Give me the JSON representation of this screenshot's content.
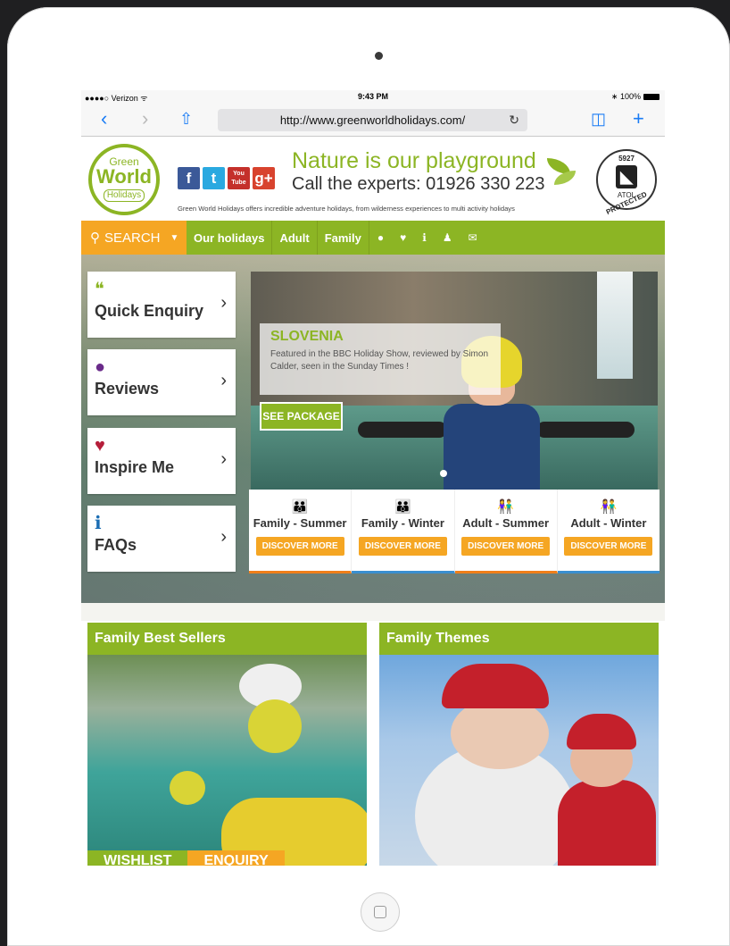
{
  "status_bar": {
    "carrier": "●●●●○ Verizon",
    "wifi": "ᯤ",
    "time": "9:43 PM",
    "battery": "100%",
    "bt": "∗"
  },
  "browser": {
    "url": "http://www.greenworldholidays.com/",
    "reload": "↻"
  },
  "logo": {
    "line1": "Green",
    "line2": "World",
    "line3": "Holidays"
  },
  "social": [
    {
      "name": "facebook",
      "glyph": "f",
      "color": "#3b5998"
    },
    {
      "name": "twitter",
      "glyph": "t",
      "color": "#2aa9e0"
    },
    {
      "name": "youtube",
      "glyph": "You Tube",
      "color": "#c4302b"
    },
    {
      "name": "google-plus",
      "glyph": "g+",
      "color": "#d8432e"
    }
  ],
  "header": {
    "tagline": "Nature is our playground",
    "phone": "Call the experts: 01926 330 223",
    "subtitle": "Green World Holidays offers incredible adventure holidays, from wilderness experiences to multi activity holidays",
    "atol_number": "5927",
    "atol_mark": "ATOL",
    "atol_protected": "PROTECTED"
  },
  "nav": {
    "search": "SEARCH",
    "items": [
      "Our holidays",
      "Adult",
      "Family"
    ],
    "icons": [
      "speech-bubble-icon",
      "heart-icon",
      "info-icon",
      "person-icon",
      "envelope-icon"
    ]
  },
  "side_cards": [
    {
      "label": "Quick Enquiry",
      "icon": "chat-icon",
      "color": "#8cb524"
    },
    {
      "label": "Reviews",
      "icon": "speech-icon",
      "color": "#6a2b8a"
    },
    {
      "label": "Inspire Me",
      "icon": "heart-icon",
      "color": "#b51e3a"
    },
    {
      "label": "FAQs",
      "icon": "info-icon",
      "color": "#1b6db3"
    }
  ],
  "hero": {
    "title": "SLOVENIA",
    "description": "Featured in the BBC Holiday Show, reviewed by Simon Calder, seen in the Sunday Times !",
    "cta": "SEE PACKAGE"
  },
  "categories": [
    {
      "label": "Family - Summer",
      "button": "DISCOVER MORE",
      "color": "#f07f1a"
    },
    {
      "label": "Family - Winter",
      "button": "DISCOVER MORE",
      "color": "#3a8fd0"
    },
    {
      "label": "Adult - Summer",
      "button": "DISCOVER MORE",
      "color": "#f07f1a"
    },
    {
      "label": "Adult - Winter",
      "button": "DISCOVER MORE",
      "color": "#3a8fd0"
    }
  ],
  "sections": [
    {
      "title": "Family Best Sellers"
    },
    {
      "title": "Family Themes"
    }
  ],
  "bottom_buttons": {
    "wishlist": "WISHLIST",
    "enquiry": "ENQUIRY"
  },
  "colors": {
    "brand_green": "#8cb524",
    "accent_orange": "#f5a623"
  }
}
